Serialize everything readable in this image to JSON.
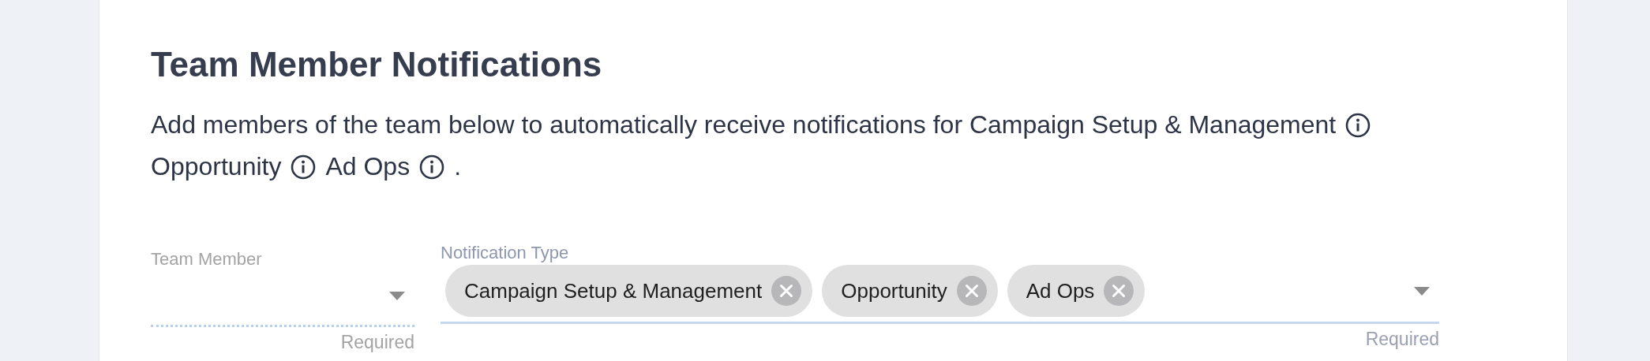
{
  "heading": "Team Member Notifications",
  "description": [
    {
      "text": "Add members of the team below to automatically receive notifications for Campaign Setup & Management",
      "info": true
    },
    {
      "text": "Opportunity",
      "info": true
    },
    {
      "text": "Ad Ops",
      "info": true
    },
    {
      "text": ".",
      "info": false
    }
  ],
  "fields": [
    {
      "label": "Team Member",
      "disabled": true,
      "helper": "Required"
    },
    {
      "label": "Notification Type",
      "disabled": false,
      "helper": "Required",
      "chips": [
        {
          "label": "Campaign Setup & Management"
        },
        {
          "label": "Opportunity"
        },
        {
          "label": "Ad Ops"
        }
      ]
    }
  ]
}
